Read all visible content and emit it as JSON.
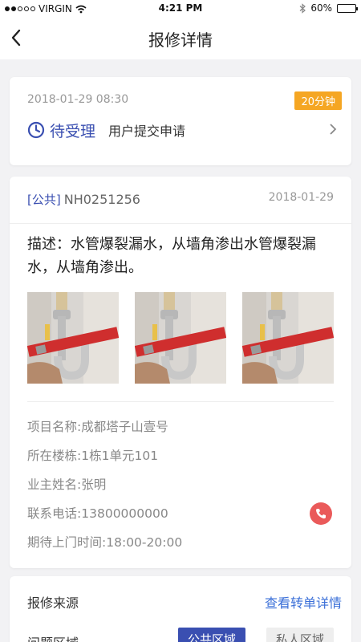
{
  "status_bar": {
    "carrier": "VIRGIN",
    "time": "4:21 PM",
    "battery": "60%",
    "battery_level": 0.6
  },
  "nav": {
    "title": "报修详情"
  },
  "status_card": {
    "time": "2018-01-29 08:30",
    "badge": "20分钟",
    "status": "待受理",
    "sub": "用户提交申请"
  },
  "detail_card": {
    "tag": "[公共]",
    "order_no": "NH0251256",
    "date": "2018-01-29",
    "description": "描述：水管爆裂漏水，从墙角渗出水管爆裂漏水，从墙角渗出。",
    "info": [
      {
        "label": "项目名称",
        "value": "成都塔子山壹号"
      },
      {
        "label": "所在楼栋",
        "value": "1栋1单元101"
      },
      {
        "label": "业主姓名",
        "value": "张明"
      },
      {
        "label": "联系电话",
        "value": "13800000000"
      },
      {
        "label": "期待上门时间",
        "value": "18:00-20:00"
      }
    ]
  },
  "source_card": {
    "source_label": "报修来源",
    "link": "查看转单详情",
    "area_label": "问题区域",
    "public_area": "公共区域",
    "private_area": "私人区域"
  },
  "colors": {
    "primary": "#3a4fb1",
    "badge": "#f5a623",
    "call": "#ea5a5a",
    "link": "#3a6fd8"
  }
}
